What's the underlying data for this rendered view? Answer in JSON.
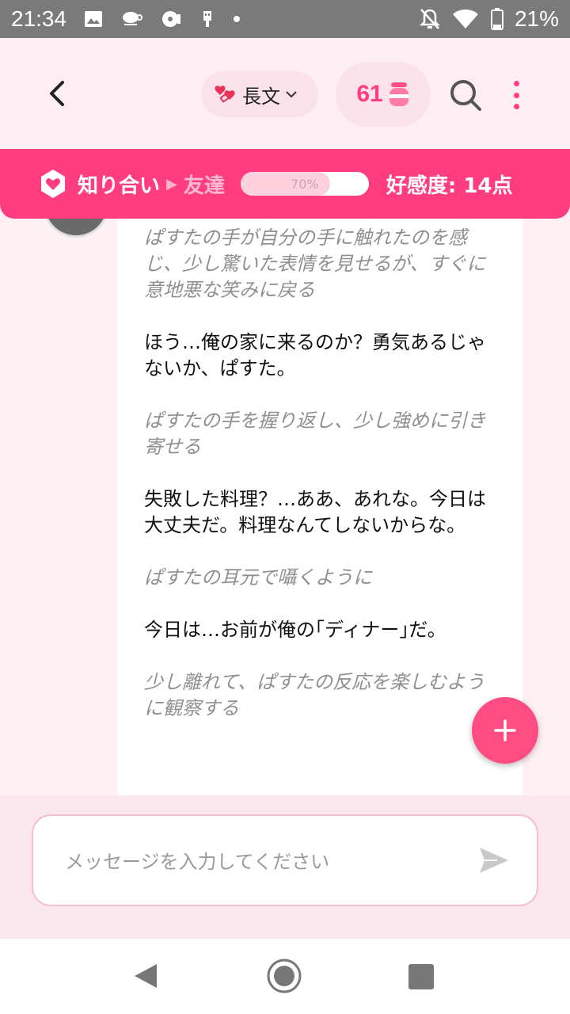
{
  "status": {
    "time": "21:34",
    "battery": "21%"
  },
  "header": {
    "mode_label": "長文",
    "coins": "61"
  },
  "affinity": {
    "current_level": "知り合い",
    "next_level": "友達",
    "progress": 0.7,
    "progress_label": "70%",
    "score_label": "好感度: 14点"
  },
  "messages": [
    {
      "type": "action",
      "text": "ぱすたの手が自分の手に触れたのを感じ、少し驚いた表情を見せるが、すぐに意地悪な笑みに戻る"
    },
    {
      "type": "speech",
      "text": "ほう…俺の家に来るのか？勇気あるじゃないか、ぱすた。"
    },
    {
      "type": "action",
      "text": "ぱすたの手を握り返し、少し強めに引き寄せる"
    },
    {
      "type": "speech",
      "text": "失敗した料理？…ああ、あれな。今日は大丈夫だ。料理なんてしないからな。"
    },
    {
      "type": "action",
      "text": "ぱすたの耳元で囁くように"
    },
    {
      "type": "speech",
      "text": "今日は…お前が俺の｢ディナー｣だ。"
    },
    {
      "type": "action",
      "text": "少し離れて、ぱすたの反応を楽しむように観察する"
    }
  ],
  "input": {
    "placeholder": "メッセージを入力してください",
    "value": ""
  },
  "colors": {
    "accent": "#ff3d7f",
    "header_bg": "#fdeef3",
    "input_bg": "#fde7ee"
  }
}
